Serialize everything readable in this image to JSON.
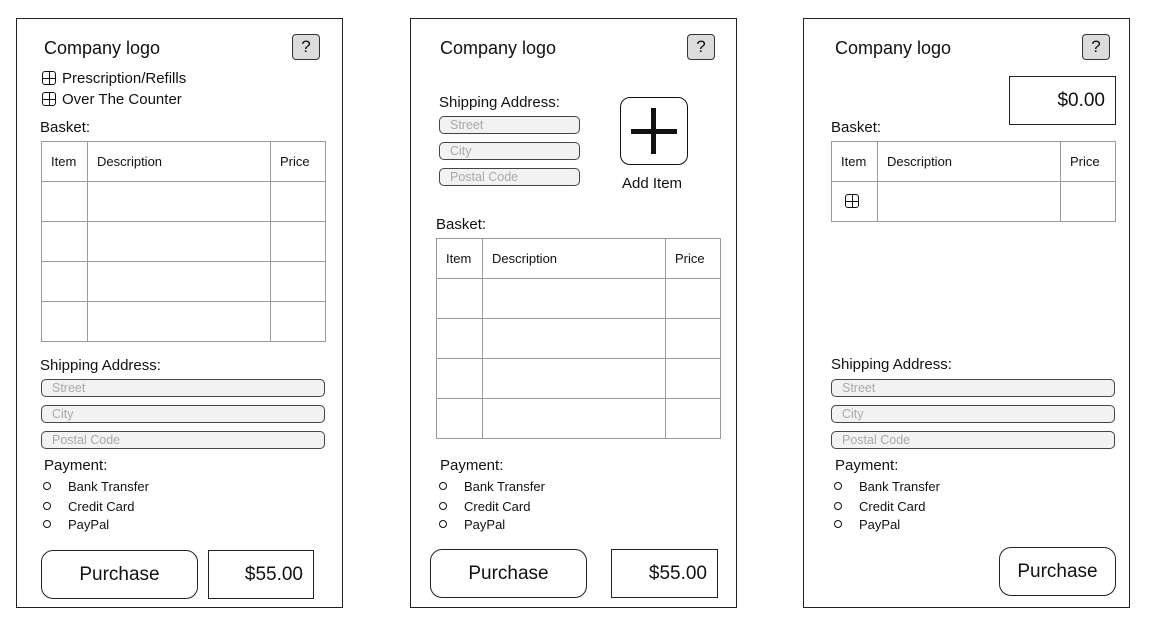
{
  "screens": [
    {
      "logo": "Company logo",
      "help": "?",
      "menu": [
        "Prescription/Refills",
        "Over The Counter"
      ],
      "basket_label": "Basket:",
      "table_headers": [
        "Item",
        "Description",
        "Price"
      ],
      "shipping_label": "Shipping Address:",
      "fields": [
        "Street",
        "City",
        "Postal Code"
      ],
      "payment_label": "Payment:",
      "payment_options": [
        "Bank Transfer",
        "Credit Card",
        "PayPal"
      ],
      "purchase": "Purchase",
      "total": "$55.00"
    },
    {
      "logo": "Company logo",
      "help": "?",
      "shipping_label": "Shipping Address:",
      "fields": [
        "Street",
        "City",
        "Postal Code"
      ],
      "add_item": "Add Item",
      "basket_label": "Basket:",
      "table_headers": [
        "Item",
        "Description",
        "Price"
      ],
      "payment_label": "Payment:",
      "payment_options": [
        "Bank Transfer",
        "Credit Card",
        "PayPal"
      ],
      "purchase": "Purchase",
      "total": "$55.00"
    },
    {
      "logo": "Company logo",
      "help": "?",
      "total": "$0.00",
      "basket_label": "Basket:",
      "table_headers": [
        "Item",
        "Description",
        "Price"
      ],
      "row_icon": "plus-square-icon",
      "shipping_label": "Shipping Address:",
      "fields": [
        "Street",
        "City",
        "Postal Code"
      ],
      "payment_label": "Payment:",
      "payment_options": [
        "Bank Transfer",
        "Credit Card",
        "PayPal"
      ],
      "purchase": "Purchase"
    }
  ]
}
